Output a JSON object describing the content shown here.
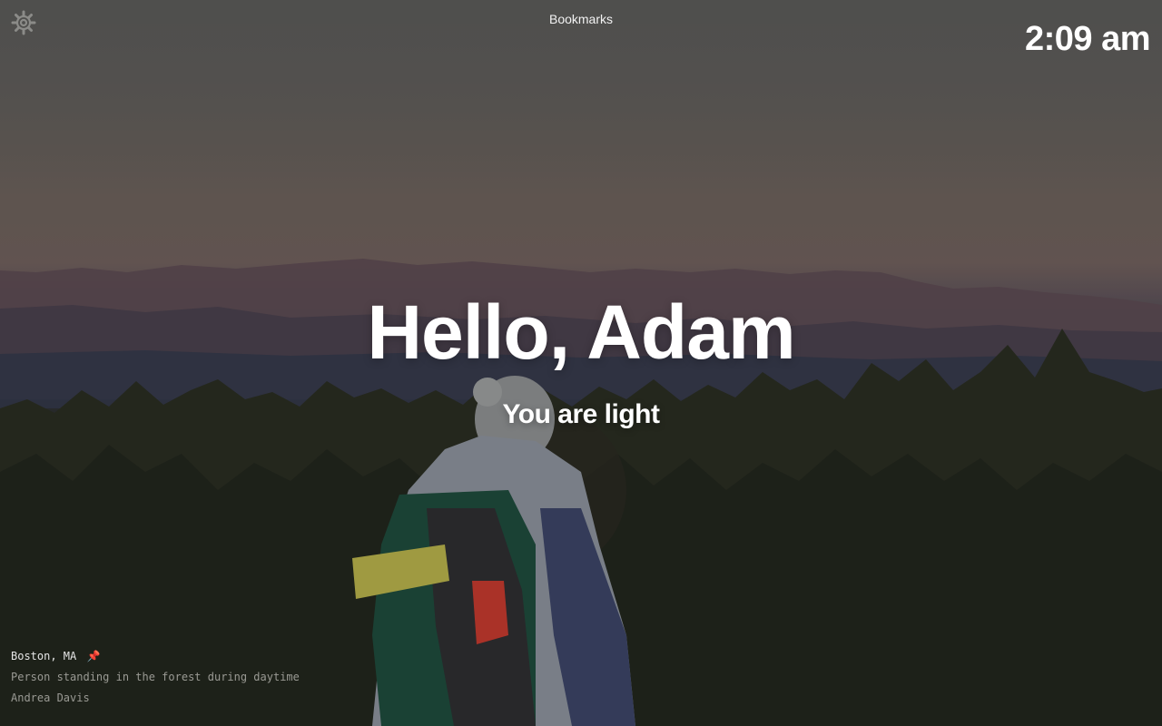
{
  "header": {
    "bookmarks_label": "Bookmarks",
    "clock": "2:09 am"
  },
  "main": {
    "greeting": "Hello, Adam",
    "mantra": "You are light"
  },
  "photo_info": {
    "location": "Boston, MA",
    "description": "Person standing in the forest during daytime",
    "author": "Andrea Davis"
  },
  "icons": {
    "settings": "gear-icon",
    "location_pin": "pin-icon"
  },
  "colors": {
    "text": "#ffffff",
    "muted_text": "#9a9a94",
    "pin": "#d9533b"
  }
}
